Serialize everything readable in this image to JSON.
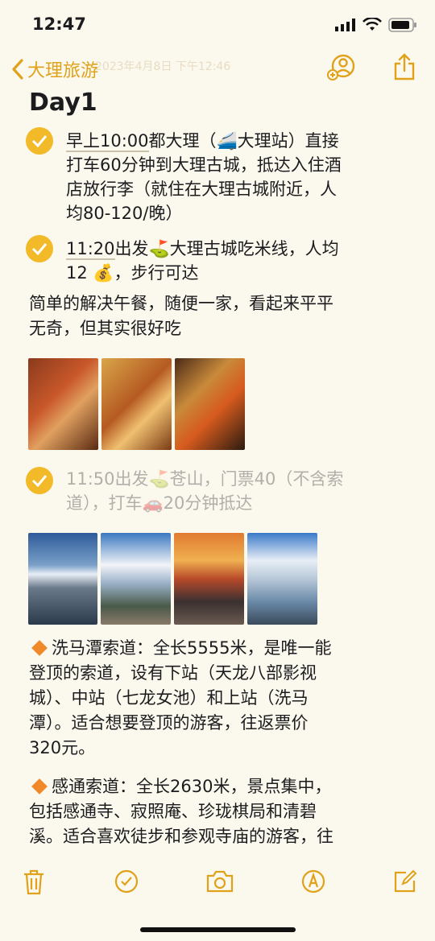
{
  "status": {
    "time": "12:47"
  },
  "nav": {
    "back_label": "大理旅游",
    "ghost_text": "2023年4月8日 下午12:46"
  },
  "note": {
    "title": "Day1",
    "item1": {
      "line1_u": "早上10:00",
      "line1_rest": "都大理（🚄大理站）直接",
      "line2": "打车60分钟到大理古城，抵达入住酒",
      "line3": "店放行李（就住在大理古城附近，人",
      "line4": "均80-120/晚）"
    },
    "item2": {
      "line1_u": "11:20",
      "line1_rest": "出发⛳大理古城吃米线，人均",
      "line2": "12 💰，步行可达"
    },
    "para1": {
      "line1": "简单的解决午餐，随便一家，看起来平平",
      "line2": "无奇，但其实很好吃"
    },
    "item3": {
      "line1": "11:50出发⛳苍山，门票40（不含索",
      "line2": "道），打车🚗20分钟抵达"
    },
    "para2": {
      "line1": "洗马潭索道：全长5555米，是唯一能",
      "line2": "登顶的索道，设有下站（天龙八部影视",
      "line3": "城）、中站（七龙女池）和上站（洗马",
      "line4": "潭）。适合想要登顶的游客，往返票价",
      "line5": "320元。"
    },
    "para3": {
      "line1": "感通索道：全长2630米，景点集中，",
      "line2": "包括感通寺、寂照庵、珍珑棋局和清碧",
      "line3": "溪。适合喜欢徒步和参观寺庙的游客，往"
    }
  },
  "colors": {
    "accent": "#e0a21a",
    "check": "#f2b928",
    "background": "#fbf8ee"
  },
  "icons": [
    "back-chevron-icon",
    "add-person-icon",
    "share-icon",
    "trash-icon",
    "checklist-icon",
    "camera-icon",
    "markup-icon",
    "compose-icon"
  ]
}
